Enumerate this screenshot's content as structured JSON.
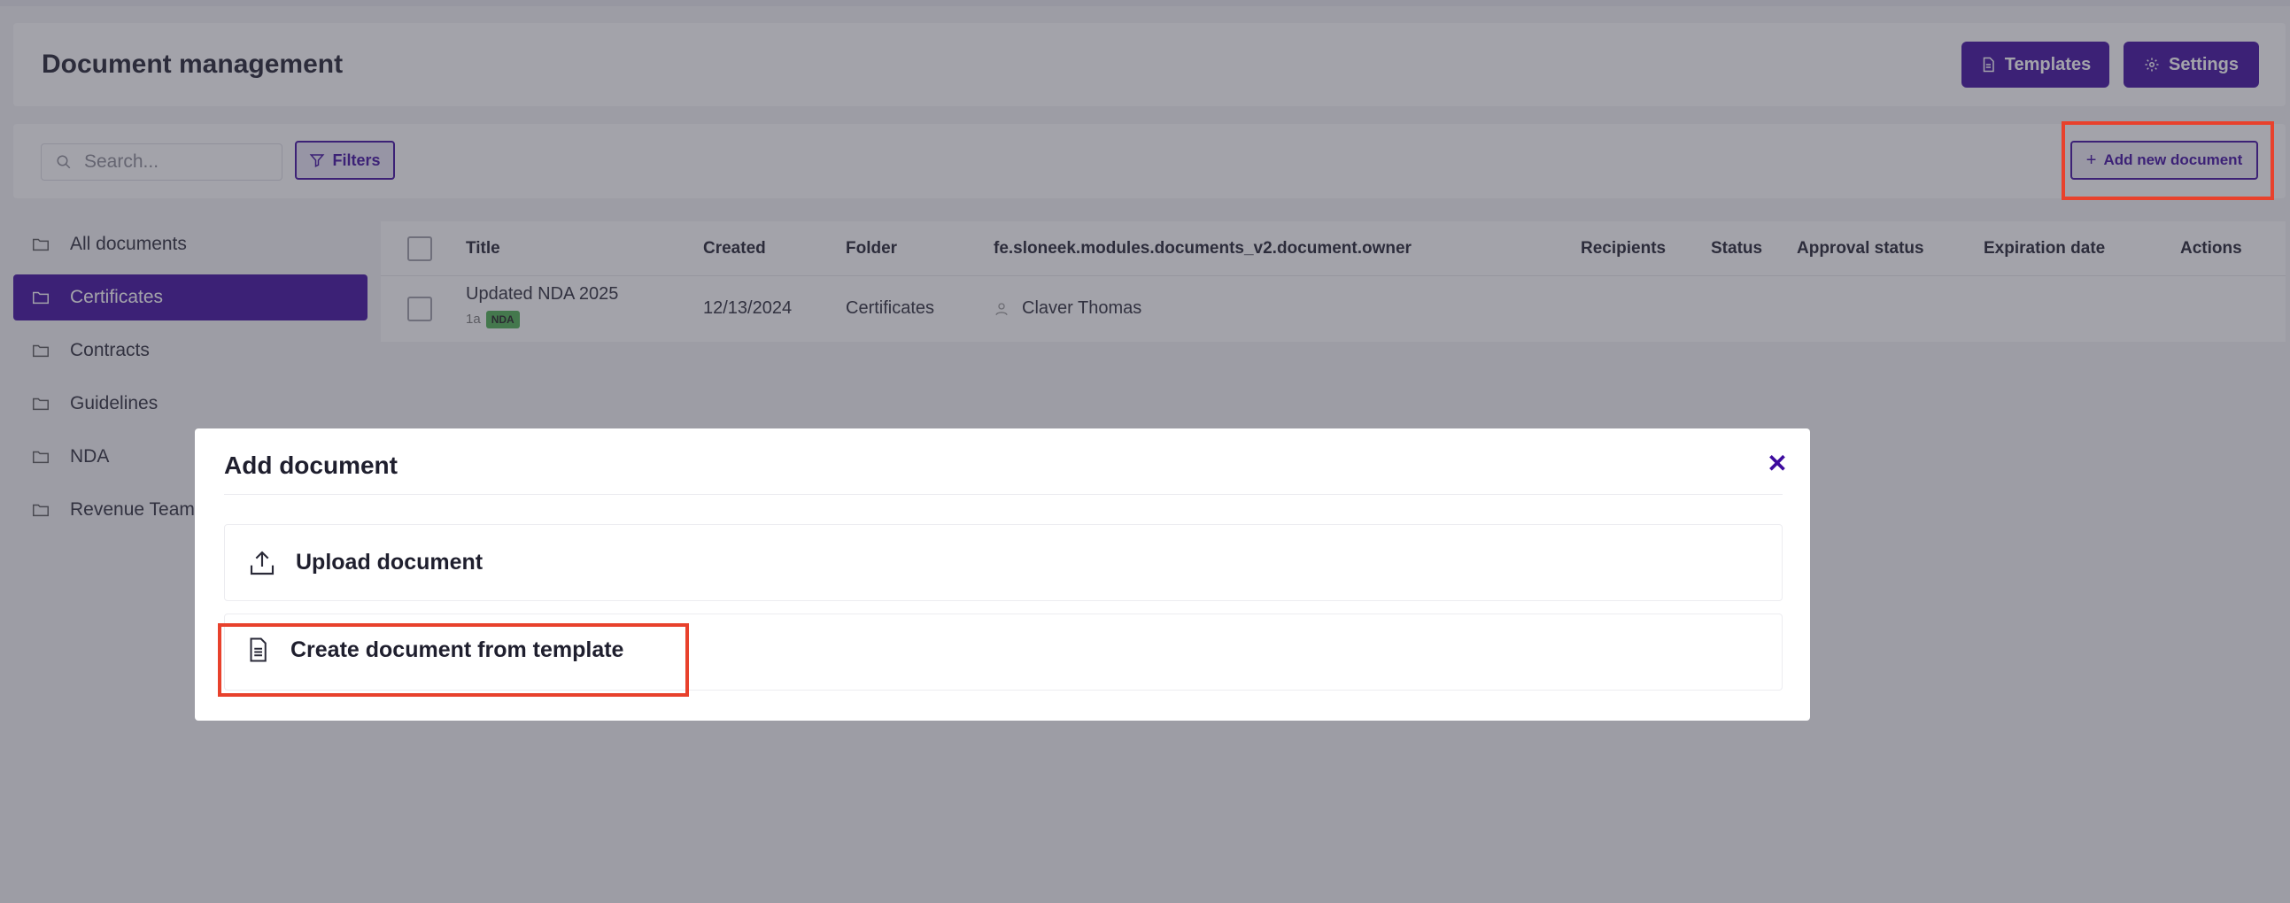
{
  "header": {
    "title": "Document management",
    "templates_label": "Templates",
    "settings_label": "Settings"
  },
  "toolbar": {
    "search_placeholder": "Search...",
    "filters_label": "Filters",
    "add_label": "Add new document"
  },
  "sidebar": {
    "items": [
      {
        "label": "All documents",
        "active": false
      },
      {
        "label": "Certificates",
        "active": true
      },
      {
        "label": "Contracts",
        "active": false
      },
      {
        "label": "Guidelines",
        "active": false
      },
      {
        "label": "NDA",
        "active": false
      },
      {
        "label": "Revenue Team",
        "active": false
      }
    ]
  },
  "table": {
    "columns": [
      "Title",
      "Created",
      "Folder",
      "fe.sloneek.modules.documents_v2.document.owner",
      "Recipients",
      "Status",
      "Approval status",
      "Expiration date",
      "Actions"
    ],
    "rows": [
      {
        "title": "Updated NDA 2025",
        "revision": "1a",
        "tag": "NDA",
        "created": "12/13/2024",
        "folder": "Certificates",
        "owner": "Claver Thomas"
      }
    ]
  },
  "modal": {
    "title": "Add document",
    "close_symbol": "✕",
    "options": [
      {
        "label": "Upload document",
        "icon": "upload-icon"
      },
      {
        "label": "Create document from template",
        "icon": "document-template-icon"
      }
    ]
  },
  "colors": {
    "brand": "#3d0b9e",
    "highlight": "#e8412c",
    "tag_green": "#4caf50"
  }
}
